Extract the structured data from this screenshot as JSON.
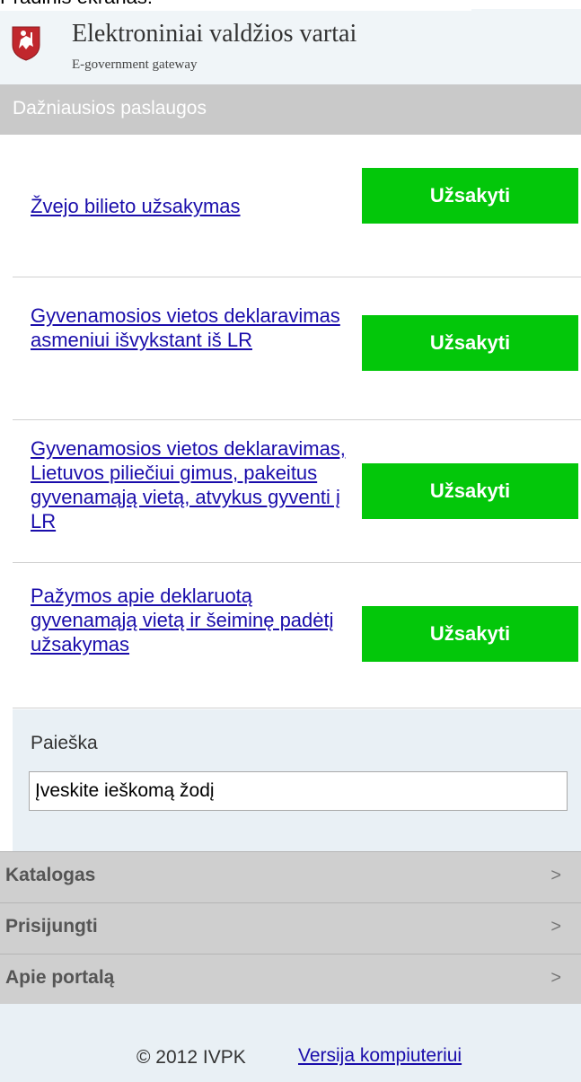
{
  "header": {
    "caption": "Pradinis ekranas:",
    "title": "Elektroniniai valdžios vartai",
    "subtitle": "E-government gateway",
    "logo_icon": "coat-of-arms-icon"
  },
  "services_section": {
    "title": "Dažniausios paslaugos",
    "items": [
      {
        "label": "Žvejo bilieto užsakymas",
        "button": "Užsakyti"
      },
      {
        "label": "Gyvenamosios vietos deklaravimas asmeniui išvykstant iš LR",
        "button": "Užsakyti"
      },
      {
        "label": "Gyvenamosios vietos deklaravimas, Lietuvos piliečiui gimus, pakeitus gyvenamąją vietą, atvykus gyventi į LR",
        "button": "Užsakyti"
      },
      {
        "label": "Pažymos apie deklaruotą gyvenamąją vietą ir šeiminę padėtį užsakymas",
        "button": "Užsakyti"
      }
    ]
  },
  "search": {
    "label": "Paieška",
    "value": "Įveskite ieškomą žodį"
  },
  "nav": {
    "items": [
      {
        "label": "Katalogas",
        "chevron": ">"
      },
      {
        "label": "Prisijungti",
        "chevron": ">"
      },
      {
        "label": "Apie portalą",
        "chevron": ">"
      }
    ]
  },
  "footer": {
    "copyright": "© 2012 IVPK",
    "desktop_link": "Versija kompiuteriui"
  },
  "colors": {
    "button_green": "#03c70a",
    "link_blue": "#1a0dab",
    "section_bar": "#c9c9c9"
  }
}
